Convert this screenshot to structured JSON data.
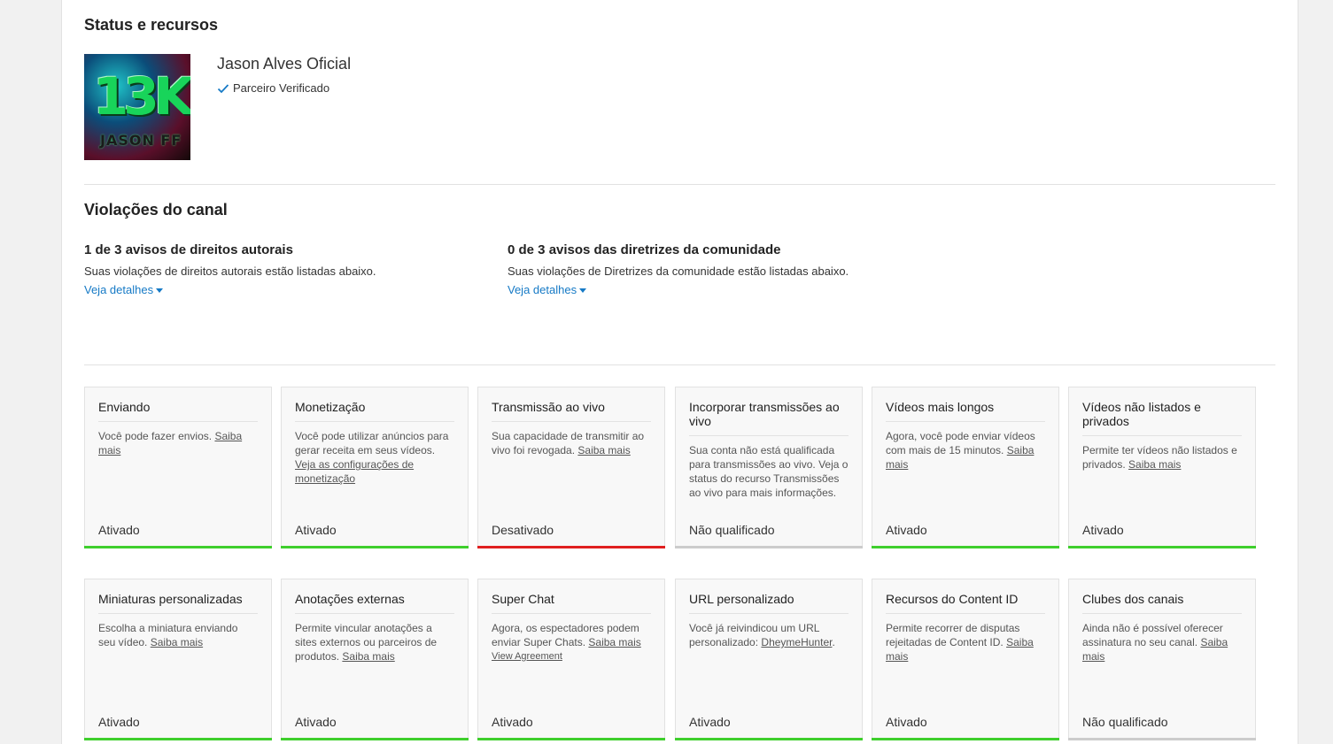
{
  "status": {
    "heading": "Status e recursos",
    "channel_name": "Jason Alves Oficial",
    "verified_label": "Parceiro Verificado",
    "thumb_text_main": "13K",
    "thumb_text_sub": "JASON FF"
  },
  "violations": {
    "heading": "Violações do canal",
    "copyright": {
      "title": "1 de 3 avisos de direitos autorais",
      "description": "Suas violações de direitos autorais estão listadas abaixo.",
      "link": "Veja detalhes"
    },
    "community": {
      "title": "0 de 3 avisos das diretrizes da comunidade",
      "description": "Suas violações de Diretrizes da comunidade estão listadas abaixo.",
      "link": "Veja detalhes"
    }
  },
  "colors": {
    "enabled": "#3fcf2d",
    "disabled": "#e02020",
    "not_qualified": "#cccccc",
    "link": "#167ac6"
  },
  "features": [
    {
      "title": "Enviando",
      "desc": "Você pode fazer envios.",
      "links": [
        "Saiba mais"
      ],
      "status": "Ativado",
      "state": "enabled"
    },
    {
      "title": "Monetização",
      "desc": "Você pode utilizar anúncios para gerar receita em seus vídeos.",
      "links": [
        "Veja as configurações de monetização"
      ],
      "status": "Ativado",
      "state": "enabled"
    },
    {
      "title": "Transmissão ao vivo",
      "desc": "Sua capacidade de transmitir ao vivo foi revogada.",
      "links": [
        "Saiba mais"
      ],
      "status": "Desativado",
      "state": "disabled"
    },
    {
      "title": "Incorporar transmissões ao vivo",
      "desc": "Sua conta não está qualificada para transmissões ao vivo. Veja o status do recurso Transmissões ao vivo para mais informações.",
      "links": [],
      "status": "Não qualificado",
      "state": "not_qualified"
    },
    {
      "title": "Vídeos mais longos",
      "desc": "Agora, você pode enviar vídeos com mais de 15 minutos.",
      "links": [
        "Saiba mais"
      ],
      "status": "Ativado",
      "state": "enabled"
    },
    {
      "title": "Vídeos não listados e privados",
      "desc": "Permite ter vídeos não listados e privados.",
      "links": [
        "Saiba mais"
      ],
      "status": "Ativado",
      "state": "enabled"
    },
    {
      "title": "Miniaturas personalizadas",
      "desc": "Escolha a miniatura enviando seu vídeo.",
      "links": [
        "Saiba mais"
      ],
      "status": "Ativado",
      "state": "enabled"
    },
    {
      "title": "Anotações externas",
      "desc": "Permite vincular anotações a sites externos ou parceiros de produtos.",
      "links": [
        "Saiba mais"
      ],
      "status": "Ativado",
      "state": "enabled"
    },
    {
      "title": "Super Chat",
      "desc": "Agora, os espectadores podem enviar Super Chats.",
      "links": [
        "Saiba mais"
      ],
      "extra_link": "View Agreement",
      "status": "Ativado",
      "state": "enabled"
    },
    {
      "title": "URL personalizado",
      "desc": "Você já reivindicou um URL personalizado:",
      "links": [
        "DheymeHunter"
      ],
      "suffix": ".",
      "status": "Ativado",
      "state": "enabled"
    },
    {
      "title": "Recursos do Content ID",
      "desc": "Permite recorrer de disputas rejeitadas de Content ID.",
      "links": [
        "Saiba mais"
      ],
      "status": "Ativado",
      "state": "enabled"
    },
    {
      "title": "Clubes dos canais",
      "desc": "Ainda não é possível oferecer assinatura no seu canal.",
      "links": [
        "Saiba mais"
      ],
      "status": "Não qualificado",
      "state": "not_qualified"
    }
  ]
}
